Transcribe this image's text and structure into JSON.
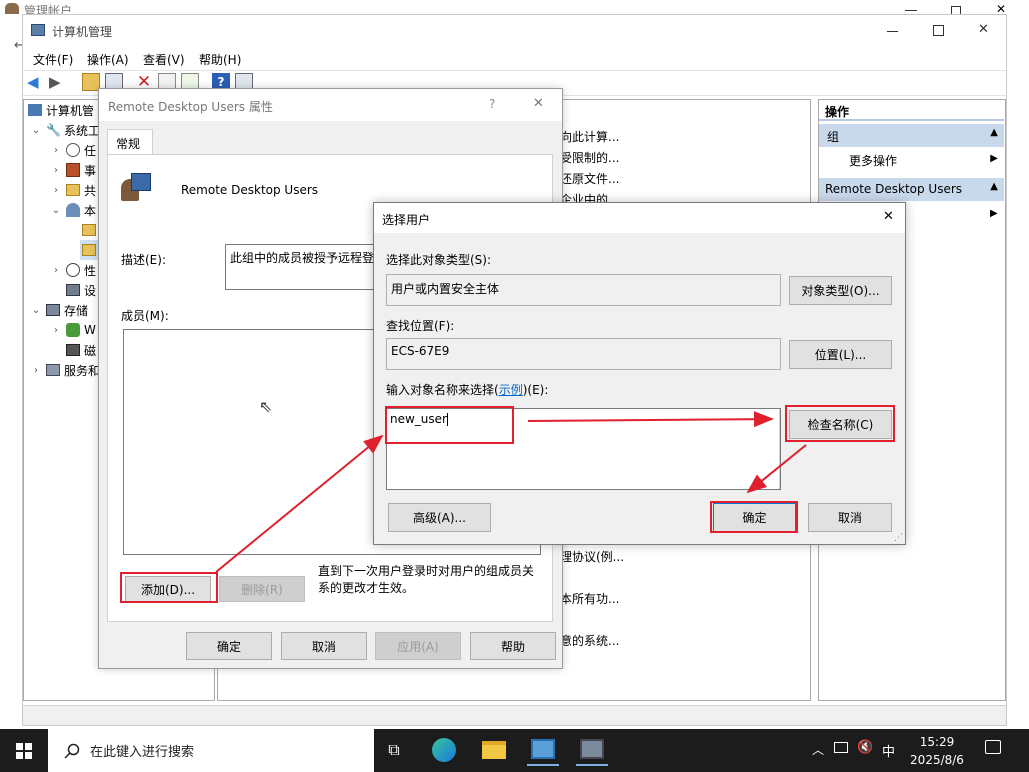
{
  "outer_window": {
    "title": "管理帐户"
  },
  "mmc": {
    "title": "计算机管理",
    "menu": [
      "文件(F)",
      "操作(A)",
      "查看(V)",
      "帮助(H)"
    ],
    "tree": {
      "root": "计算机管",
      "system_tools": "系统工",
      "task_scheduler": "任",
      "event_viewer": "事",
      "shared_folders": "共",
      "local_users": "本",
      "performance": "性",
      "device_manager": "设",
      "storage": "存储",
      "windows_backup": "W",
      "disk_management": "磁",
      "services": "服务和"
    },
    "middle_fragments": [
      "向此计算...",
      "受限制的...",
      "还原文件...",
      "企业中的...",
      "理协议(例...",
      "本所有功...",
      "意的系统..."
    ],
    "actions": {
      "header": "操作",
      "group_header": "组",
      "more_actions": "更多操作",
      "selected_header": "Remote Desktop Users"
    }
  },
  "properties_dialog": {
    "title": "Remote Desktop Users 属性",
    "help_glyph": "?",
    "tab": "常规",
    "group_name": "Remote Desktop Users",
    "description_label": "描述(E):",
    "description_value": "此组中的成员被授予远程登",
    "members_label": "成员(M):",
    "add_button": "添加(D)...",
    "remove_button": "删除(R)",
    "note": "直到下一次用户登录时对用户的组成员关系的更改才生效。",
    "ok": "确定",
    "cancel": "取消",
    "apply": "应用(A)",
    "help": "帮助"
  },
  "select_users_dialog": {
    "title": "选择用户",
    "object_type_label": "选择此对象类型(S):",
    "object_type_value": "用户或内置安全主体",
    "object_type_button": "对象类型(O)...",
    "location_label": "查找位置(F):",
    "location_value": "ECS-67E9",
    "location_button": "位置(L)...",
    "names_label_prefix": "输入对象名称来选择(",
    "names_label_link": "示例",
    "names_label_suffix": ")(E):",
    "names_value": "new_user",
    "check_names_button": "检查名称(C)",
    "advanced_button": "高级(A)...",
    "ok": "确定",
    "cancel": "取消"
  },
  "taskbar": {
    "search_placeholder": "在此键入进行搜索",
    "ime": "中",
    "time": "15:29",
    "date": "2025/8/6"
  },
  "colors": {
    "annotation_red": "#e0202c",
    "taskbar": "#1c1c1c",
    "selection_blue": "#cfe0f2"
  }
}
